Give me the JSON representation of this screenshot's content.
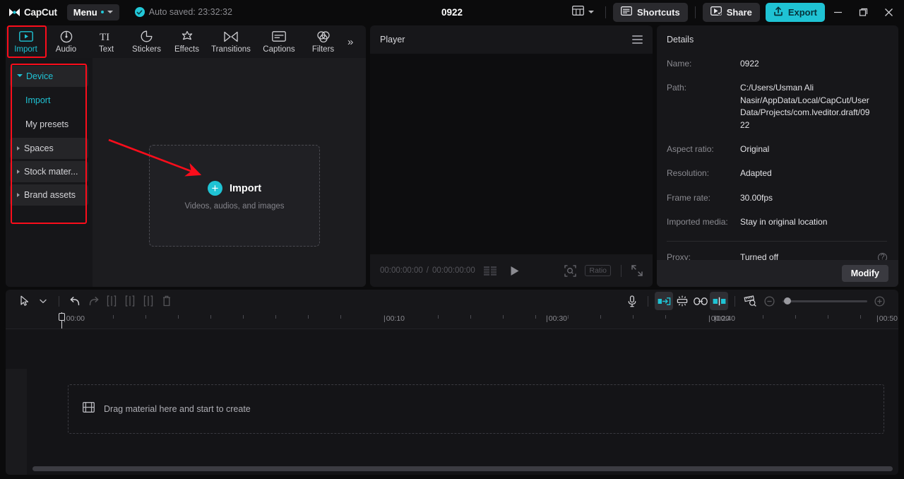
{
  "titlebar": {
    "brand": "CapCut",
    "menu_label": "Menu",
    "autosaved": "Auto saved: 23:32:32",
    "project_title": "0922",
    "shortcuts_label": "Shortcuts",
    "share_label": "Share",
    "export_label": "Export",
    "accent": "#1fc3d4",
    "icons": {
      "layout": "layout-icon",
      "layout_caret": "chevron-down-icon",
      "shortcuts": "keyboard-icon",
      "share": "share-icon",
      "export": "upload-icon",
      "minimize": "minimize-icon",
      "maximize": "maximize-icon",
      "close": "close-icon"
    }
  },
  "tabs": [
    {
      "label": "Import",
      "icon": "import-media-icon",
      "active": true
    },
    {
      "label": "Audio",
      "icon": "audio-note-icon",
      "active": false
    },
    {
      "label": "Text",
      "icon": "text-ti-icon",
      "active": false
    },
    {
      "label": "Stickers",
      "icon": "sticker-icon",
      "active": false
    },
    {
      "label": "Effects",
      "icon": "effects-sparkle-icon",
      "active": false
    },
    {
      "label": "Transitions",
      "icon": "transitions-icon",
      "active": false
    },
    {
      "label": "Captions",
      "icon": "captions-icon",
      "active": false
    },
    {
      "label": "Filters",
      "icon": "filters-icon",
      "active": false
    }
  ],
  "tabs_overflow": "»",
  "sidebar": {
    "items": [
      {
        "label": "Device",
        "type": "group",
        "expanded": true,
        "selected": true
      },
      {
        "label": "Import",
        "type": "sub",
        "active": true
      },
      {
        "label": "My presets",
        "type": "sub",
        "active": false
      },
      {
        "label": "Spaces",
        "type": "group",
        "expanded": false,
        "selected": false
      },
      {
        "label": "Stock mater...",
        "type": "group",
        "expanded": false,
        "selected": false
      },
      {
        "label": "Brand assets",
        "type": "group",
        "expanded": false,
        "selected": false
      }
    ]
  },
  "dropzone": {
    "title": "Import",
    "subtitle": "Videos, audios, and images",
    "plus": "+"
  },
  "player": {
    "title": "Player",
    "current_time": "00:00:00:00",
    "separator": "/",
    "total_time": "00:00:00:00",
    "ratio_label": "Ratio",
    "icons": {
      "menu": "hamburger-icon",
      "quality": "quality-bars-icon",
      "play": "play-icon",
      "zoom_fit": "zoom-fit-icon",
      "fullscreen": "fullscreen-icon"
    }
  },
  "details": {
    "title": "Details",
    "rows": [
      {
        "label": "Name:",
        "value": "0922"
      },
      {
        "label": "Path:",
        "value": "C:/Users/Usman Ali Nasir/AppData/Local/CapCut/User Data/Projects/com.lveditor.draft/0922"
      },
      {
        "label": "Aspect ratio:",
        "value": "Original"
      },
      {
        "label": "Resolution:",
        "value": "Adapted"
      },
      {
        "label": "Frame rate:",
        "value": "30.00fps"
      },
      {
        "label": "Imported media:",
        "value": "Stay in original location"
      }
    ],
    "proxy_label": "Proxy:",
    "proxy_value": "Turned off",
    "help_icon": "help-circle-icon",
    "modify_label": "Modify"
  },
  "timeline": {
    "placeholder": "Drag material here and start to create",
    "placeholder_icon": "filmstrip-icon",
    "ruler_labels": [
      "00:00",
      "00:10",
      "00:20",
      "00:30",
      "00:40",
      "00:50"
    ],
    "tools_left": [
      {
        "name": "select-cursor-icon",
        "state": "enabled"
      },
      {
        "name": "cursor-dropdown-chevron-icon",
        "state": "enabled"
      },
      {
        "name": "undo-icon",
        "state": "enabled"
      },
      {
        "name": "redo-icon",
        "state": "disabled"
      },
      {
        "name": "split-icon",
        "state": "disabled"
      },
      {
        "name": "trim-left-icon",
        "state": "disabled"
      },
      {
        "name": "trim-right-icon",
        "state": "disabled"
      },
      {
        "name": "delete-icon",
        "state": "disabled"
      }
    ],
    "tools_right": [
      {
        "name": "microphone-icon",
        "state": "enabled"
      },
      {
        "name": "auto-snap-icon",
        "state": "active"
      },
      {
        "name": "adjust-icon",
        "state": "enabled"
      },
      {
        "name": "link-icon",
        "state": "enabled"
      },
      {
        "name": "mirror-split-icon",
        "state": "active"
      },
      {
        "name": "timeline-preview-icon",
        "state": "enabled"
      },
      {
        "name": "zoom-out-icon",
        "state": "disabled"
      },
      {
        "name": "zoom-slider",
        "state": "enabled"
      },
      {
        "name": "zoom-in-icon",
        "state": "disabled"
      }
    ]
  },
  "annotations": {
    "highlight_color": "#fb0d1b",
    "arrow": "red-arrow-pointing-to-import-button",
    "boxes": [
      "import-tab-highlight",
      "device-sidebar-highlight"
    ]
  }
}
